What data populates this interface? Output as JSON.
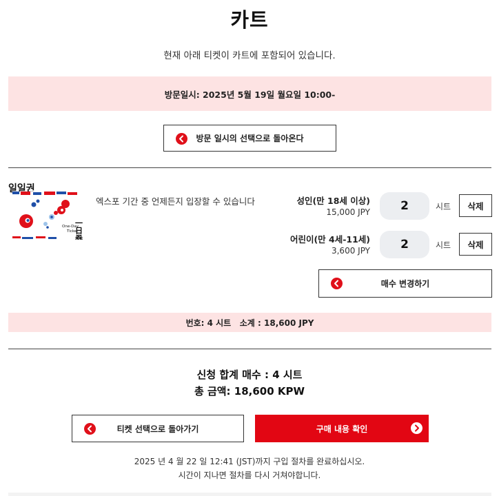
{
  "page": {
    "title": "카트",
    "subtitle": "현재 아래 티켓이 카트에 포함되어 있습니다."
  },
  "visit": {
    "text": "방문일시: 2025년 5월 19일 월요일 10:00-"
  },
  "buttons": {
    "back_to_date": "방문 일시의 선택으로 돌아온다",
    "change_qty": "매수 변경하기",
    "back_to_ticket": "티켓 선택으로 돌아가기",
    "confirm": "구매 내용 확인"
  },
  "ticket": {
    "name": "일일권",
    "description": "엑스포 기간 중 언제든지 입장할 수 있습니다",
    "image_text": {
      "kanji": "一日券",
      "english_line1": "One-Day",
      "english_line2": "Ticket"
    },
    "prices": [
      {
        "label": "성인(만 18세 이상)",
        "price": "15,000 JPY",
        "qty": "2",
        "unit": "시트",
        "delete": "삭제"
      },
      {
        "label": "어린이(만 4세-11세)",
        "price": "3,600 JPY",
        "qty": "2",
        "unit": "시트",
        "delete": "삭제"
      }
    ]
  },
  "subtotal": {
    "text": "번호: 4 시트   소계 : 18,600 JPY"
  },
  "totals": {
    "count": "신청 합계 매수 : 4 시트",
    "amount": "총 금액: 18,600 KPW"
  },
  "notice": {
    "line1": "2025 년 4 월 22 일 12:41 (JST)까지 구입 절차를 완료하십시오.",
    "line2": "시간이 지나면 절차를 다시 거쳐야합니다."
  },
  "colors": {
    "accent_red": "#e20613",
    "band_pink": "#fde3e3",
    "qty_bg": "#eceef1"
  }
}
